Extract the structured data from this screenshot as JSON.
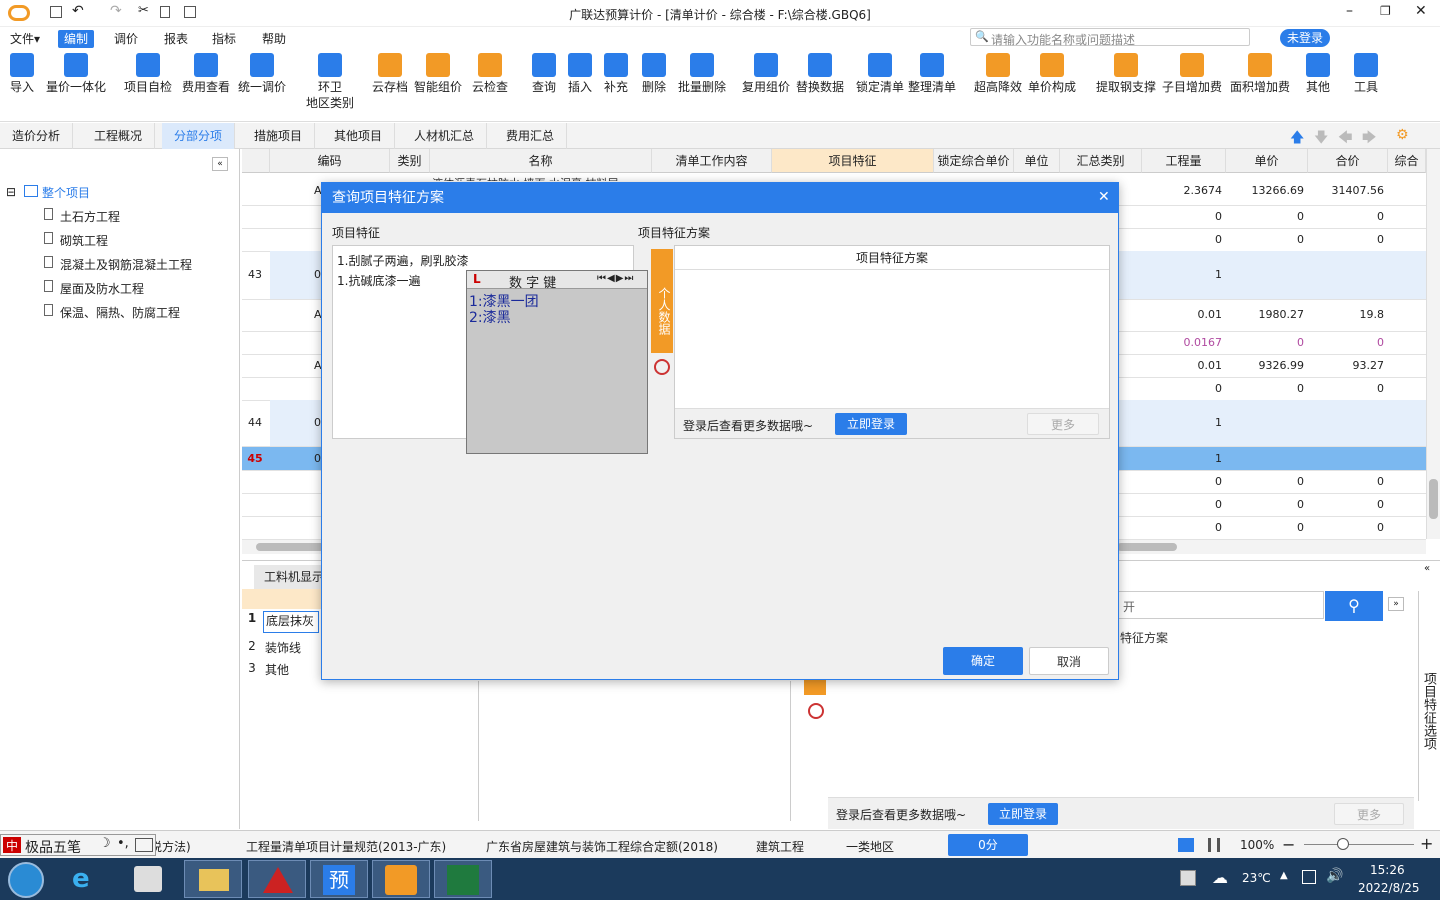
{
  "window": {
    "title": "广联达预算计价 - [清单计价 - 综合楼 - F:\\综合楼.GBQ6]"
  },
  "menu": {
    "items": [
      "文件▾",
      "编制",
      "调价",
      "报表",
      "指标",
      "帮助"
    ],
    "search_placeholder": "请输入功能名称或问题描述",
    "login": "未登录"
  },
  "ribbon": {
    "buttons": [
      "导入",
      "量价一体化",
      "项目自检",
      "费用查看",
      "统一调价",
      "环卫\n地区类别",
      "云存档",
      "智能组价",
      "云检查",
      "查询",
      "插入",
      "补充",
      "删除",
      "批量删除",
      "复用组价",
      "替换数据",
      "锁定清单",
      "整理清单",
      "超高降效",
      "单价构成",
      "提取钢支撑",
      "子目增加费",
      "面积增加费",
      "其他",
      "工具"
    ]
  },
  "tabs": [
    "造价分析",
    "工程概况",
    "分部分项",
    "措施项目",
    "其他项目",
    "人材机汇总",
    "费用汇总"
  ],
  "tree": {
    "root": "整个项目",
    "items": [
      "土石方工程",
      "砌筑工程",
      "混凝土及钢筋混凝土工程",
      "屋面及防水工程",
      "保温、隔热、防腐工程"
    ]
  },
  "grid": {
    "headers": [
      "编码",
      "类别",
      "名称",
      "清单工作内容",
      "项目特征",
      "锁定综合单价",
      "单位",
      "汇总类别",
      "工程量",
      "单价",
      "合价",
      "综合"
    ],
    "rows": [
      {
        "no": "",
        "code": "A",
        "qty": "2.3674",
        "price": "13266.69",
        "total": "31407.56"
      },
      {
        "no": "",
        "code": "",
        "qty": "0",
        "price": "0",
        "total": "0"
      },
      {
        "no": "",
        "code": "",
        "qty": "0",
        "price": "0",
        "total": "0"
      },
      {
        "no": "43",
        "code": "011",
        "qty": "1",
        "price": "",
        "total": ""
      },
      {
        "no": "",
        "code": "A",
        "qty": "0.01",
        "price": "1980.27",
        "total": "19.8"
      },
      {
        "no": "",
        "code": "",
        "qty": "0.0167",
        "price": "0",
        "total": "0"
      },
      {
        "no": "",
        "code": "A",
        "qty": "0.01",
        "price": "9326.99",
        "total": "93.27"
      },
      {
        "no": "",
        "code": "",
        "qty": "0",
        "price": "0",
        "total": "0"
      },
      {
        "no": "44",
        "code": "011",
        "qty": "1",
        "price": "",
        "total": ""
      },
      {
        "no": "45",
        "code": "011",
        "qty": "1",
        "price": "",
        "total": ""
      },
      {
        "no": "",
        "code": "",
        "qty": "0",
        "price": "0",
        "total": "0"
      },
      {
        "no": "",
        "code": "",
        "qty": "0",
        "price": "0",
        "total": "0"
      },
      {
        "no": "",
        "code": "",
        "qty": "0",
        "price": "0",
        "total": "0"
      }
    ],
    "partial_name": "液体沥青石柱防水 墙面 水泥膏 抹料层"
  },
  "bottom": {
    "tab": "工料机显示",
    "list": [
      "底层抹灰",
      "装饰线",
      "其他"
    ],
    "search_placeholder": "开",
    "scheme_label": "特征方案",
    "side_label": "项目特征选项",
    "login_hint": "登录后查看更多数据哦~",
    "login_btn": "立即登录",
    "more": "更多"
  },
  "dialog": {
    "title": "查询项目特征方案",
    "left_label": "项目特征",
    "right_label": "项目特征方案",
    "feature_lines": [
      "1.刮腻子两遍，刷乳胶漆",
      "1.抗碱底漆一遍"
    ],
    "personal_tab": "个人数据",
    "scheme_header": "项目特征方案",
    "login_hint": "登录后查看更多数据哦~",
    "login_btn": "立即登录",
    "more": "更多",
    "ok": "确定",
    "cancel": "取消"
  },
  "ime": {
    "title": "数 字 键",
    "candidates": [
      "1:漆黑一团",
      "2:漆黑"
    ],
    "bar_name": "极品五笔"
  },
  "status": {
    "items": [
      "说方法)",
      "工程量清单项目计量规范(2013-广东)",
      "广东省房屋建筑与装饰工程综合定额(2018)",
      "建筑工程",
      "一类地区"
    ],
    "score": "0分",
    "zoom": "100%"
  },
  "taskbar": {
    "temp": "23℃",
    "time": "15:26",
    "date": "2022/8/25"
  }
}
